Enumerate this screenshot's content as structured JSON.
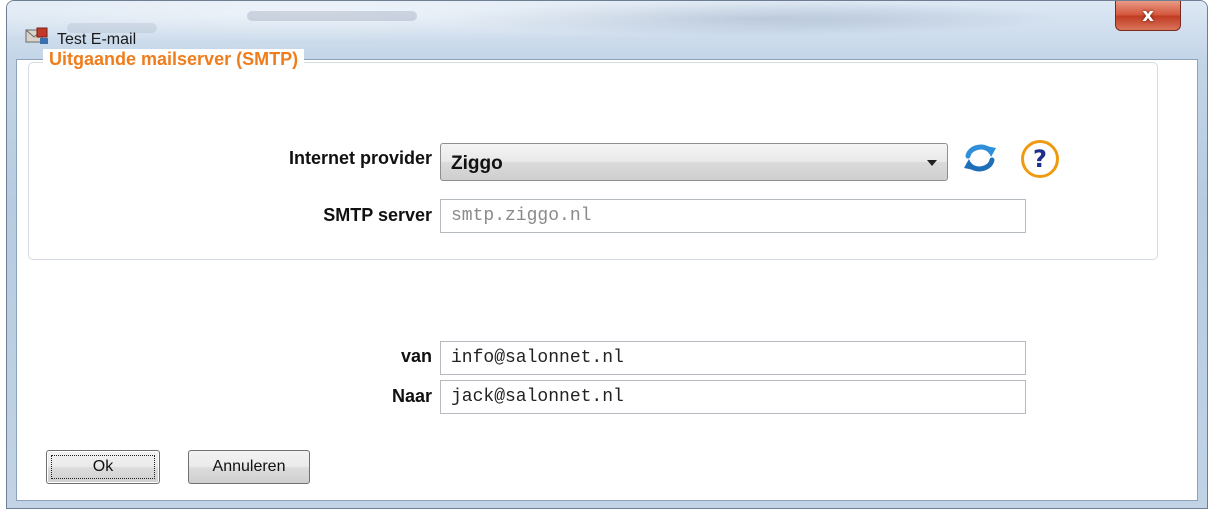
{
  "window": {
    "title": "Test E-mail",
    "close_label": "x"
  },
  "smtp_group": {
    "legend": "Uitgaande mailserver (SMTP)",
    "provider_label": "Internet provider",
    "provider_value": "Ziggo",
    "server_label": "SMTP server",
    "server_value": "smtp.ziggo.nl",
    "help_label": "?"
  },
  "mail": {
    "from_label": "van",
    "from_value": "info@salonnet.nl",
    "to_label": "Naar",
    "to_value": "jack@salonnet.nl"
  },
  "buttons": {
    "ok": "Ok",
    "cancel": "Annuleren"
  },
  "icons": {
    "app": "mail-app-icon",
    "refresh": "refresh-icon",
    "help": "help-icon",
    "dropdown": "chevron-down-icon"
  },
  "colors": {
    "legend": "#f07d1c",
    "help_ring": "#f09a12",
    "help_glyph": "#1d2f8c",
    "close_button": "#c03b22"
  }
}
